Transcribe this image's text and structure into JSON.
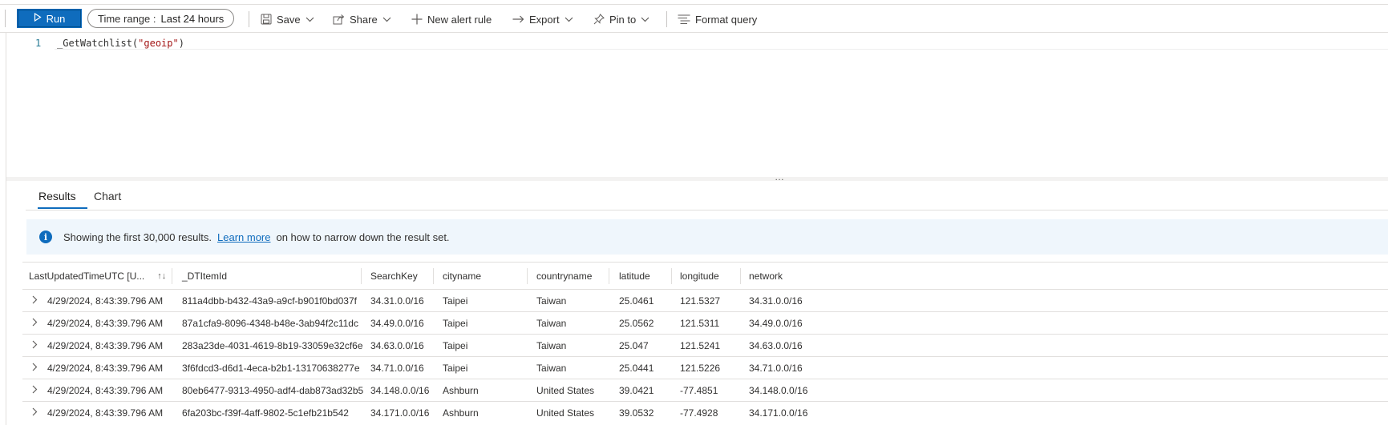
{
  "toolbar": {
    "run_label": "Run",
    "time_range_label": "Time range :",
    "time_range_value": "Last 24 hours",
    "save_label": "Save",
    "share_label": "Share",
    "new_alert_label": "New alert rule",
    "export_label": "Export",
    "pin_label": "Pin to",
    "format_label": "Format query"
  },
  "editor": {
    "line_number": "1",
    "code_prefix": "_GetWatchlist(",
    "code_string": "\"geoip\"",
    "code_suffix": ")"
  },
  "grip": "…",
  "tabs": {
    "results": "Results",
    "chart": "Chart"
  },
  "banner": {
    "text_before": "Showing the first 30,000 results.",
    "link": "Learn more",
    "text_after": "on how to narrow down the result set."
  },
  "table": {
    "columns": [
      "LastUpdatedTimeUTC [U...",
      "_DTItemId",
      "SearchKey",
      "cityname",
      "countryname",
      "latitude",
      "longitude",
      "network"
    ],
    "rows": [
      [
        "4/29/2024, 8:43:39.796 AM",
        "811a4dbb-b432-43a9-a9cf-b901f0bd037f",
        "34.31.0.0/16",
        "Taipei",
        "Taiwan",
        "25.0461",
        "121.5327",
        "34.31.0.0/16"
      ],
      [
        "4/29/2024, 8:43:39.796 AM",
        "87a1cfa9-8096-4348-b48e-3ab94f2c11dc",
        "34.49.0.0/16",
        "Taipei",
        "Taiwan",
        "25.0562",
        "121.5311",
        "34.49.0.0/16"
      ],
      [
        "4/29/2024, 8:43:39.796 AM",
        "283a23de-4031-4619-8b19-33059e32cf6e",
        "34.63.0.0/16",
        "Taipei",
        "Taiwan",
        "25.047",
        "121.5241",
        "34.63.0.0/16"
      ],
      [
        "4/29/2024, 8:43:39.796 AM",
        "3f6fdcd3-d6d1-4eca-b2b1-13170638277e",
        "34.71.0.0/16",
        "Taipei",
        "Taiwan",
        "25.0441",
        "121.5226",
        "34.71.0.0/16"
      ],
      [
        "4/29/2024, 8:43:39.796 AM",
        "80eb6477-9313-4950-adf4-dab873ad32b5",
        "34.148.0.0/16",
        "Ashburn",
        "United States",
        "39.0421",
        "-77.4851",
        "34.148.0.0/16"
      ],
      [
        "4/29/2024, 8:43:39.796 AM",
        "6fa203bc-f39f-4aff-9802-5c1efb21b542",
        "34.171.0.0/16",
        "Ashburn",
        "United States",
        "39.0532",
        "-77.4928",
        "34.171.0.0/16"
      ]
    ]
  },
  "colors": {
    "accent": "#0f6cbd",
    "banner_bg": "#eff6fc"
  }
}
